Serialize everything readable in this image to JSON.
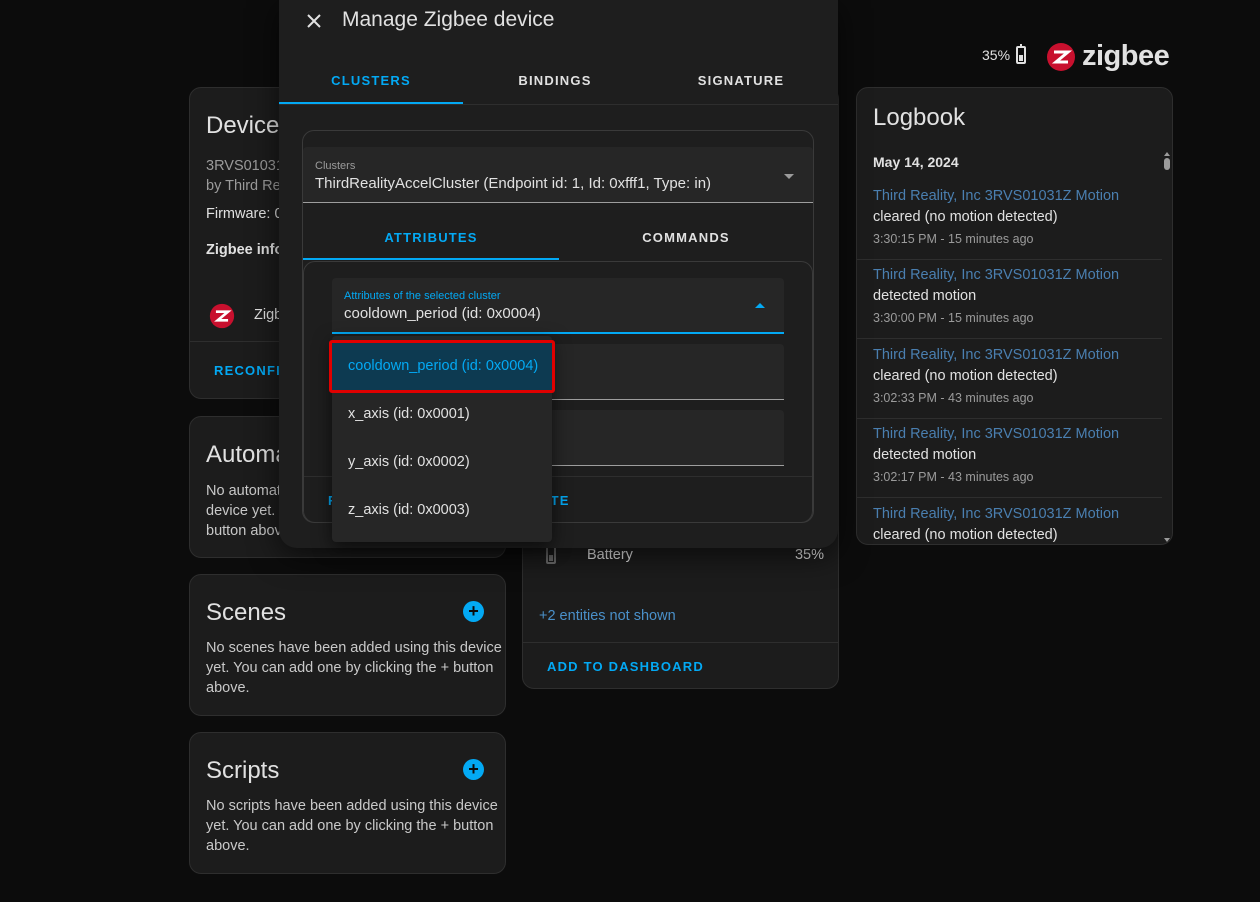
{
  "header": {
    "battery_text": "35%",
    "brand": "zigbee"
  },
  "device_card": {
    "title": "Device",
    "model": "3RVS01031",
    "manufacturer": "by Third Rea",
    "firmware": "Firmware: 0",
    "zigbee_info": "Zigbee info",
    "zigbee_item": "Zigb",
    "reconfigure": "RECONFIG"
  },
  "automations_card": {
    "title": "Automa",
    "text": [
      "No automat",
      "device yet. Y",
      "button above"
    ]
  },
  "scenes_card": {
    "title": "Scenes",
    "text": [
      "No scenes have been added using this device",
      "yet. You can add one by clicking the + button",
      "above."
    ]
  },
  "scripts_card": {
    "title": "Scripts",
    "text": [
      "No scripts have been added using this device",
      "yet. You can add one by clicking the + button",
      "above."
    ]
  },
  "sensors_card": {
    "battery_label": "Battery",
    "battery_value": "35%",
    "hidden_entities": "+2 entities not shown",
    "add_to_dashboard": "ADD TO DASHBOARD"
  },
  "dialog": {
    "title": "Manage Zigbee device",
    "tabs": [
      "CLUSTERS",
      "BINDINGS",
      "SIGNATURE"
    ],
    "clusters_label": "Clusters",
    "clusters_value": "ThirdRealityAccelCluster (Endpoint id: 1, Id: 0xfff1, Type: in)",
    "subtabs": [
      "ATTRIBUTES",
      "COMMANDS"
    ],
    "attributes_label": "Attributes of the selected cluster",
    "attributes_value": "cooldown_period (id: 0x0004)",
    "footer_left": "R",
    "footer_right": "UTE",
    "menu_items": [
      "cooldown_period (id: 0x0004)",
      "x_axis (id: 0x0001)",
      "y_axis (id: 0x0002)",
      "z_axis (id: 0x0003)"
    ]
  },
  "logbook": {
    "title": "Logbook",
    "date": "May 14, 2024",
    "entries": [
      {
        "entity": "Third Reality, Inc 3RVS01031Z Motion",
        "message": "cleared (no motion detected)",
        "time": "3:30:15 PM - 15 minutes ago"
      },
      {
        "entity": "Third Reality, Inc 3RVS01031Z Motion",
        "message": "detected motion",
        "time": "3:30:00 PM - 15 minutes ago"
      },
      {
        "entity": "Third Reality, Inc 3RVS01031Z Motion",
        "message": "cleared (no motion detected)",
        "time": "3:02:33 PM - 43 minutes ago"
      },
      {
        "entity": "Third Reality, Inc 3RVS01031Z Motion",
        "message": "detected motion",
        "time": "3:02:17 PM - 43 minutes ago"
      },
      {
        "entity": "Third Reality, Inc 3RVS01031Z Motion",
        "message": "cleared (no motion detected)",
        "time": ""
      }
    ]
  },
  "colors": {
    "accent": "#03a9f4",
    "highlight_border": "#e00000",
    "zigbee_red": "#c8102e"
  }
}
